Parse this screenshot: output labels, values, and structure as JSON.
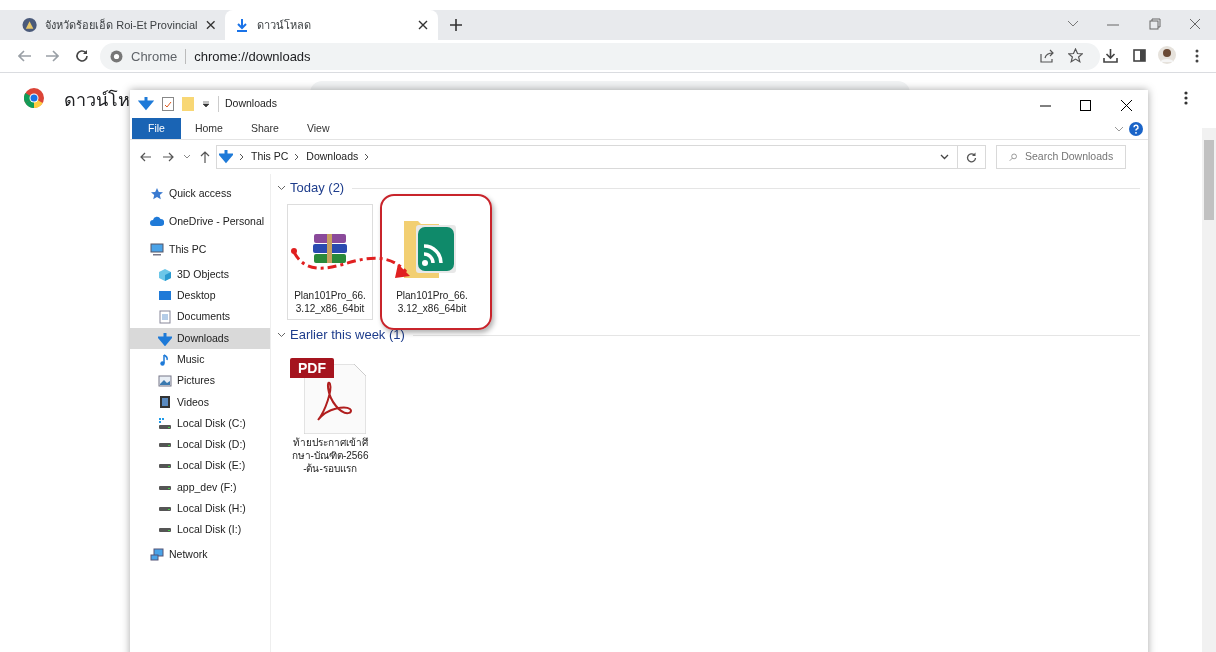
{
  "browser": {
    "tabs": [
      {
        "title": "จังหวัดร้อยเอ็ด Roi-Et Provincial",
        "kind": "seal",
        "selected": false
      },
      {
        "title": "ดาวน์โหลด",
        "kind": "download",
        "selected": true
      }
    ],
    "address": {
      "scheme_label": "Chrome",
      "url": "chrome://downloads"
    }
  },
  "page": {
    "heading": "ดาวน์โห"
  },
  "explorer": {
    "title": "Downloads",
    "ribbon_tabs": [
      {
        "label": "File",
        "selected": true
      },
      {
        "label": "Home",
        "selected": false
      },
      {
        "label": "Share",
        "selected": false
      },
      {
        "label": "View",
        "selected": false
      }
    ],
    "breadcrumb": [
      "This PC",
      "Downloads"
    ],
    "search": {
      "placeholder": "Search Downloads"
    },
    "nav": [
      {
        "label": "Quick access",
        "kind": "star",
        "selected": false
      },
      {
        "label": "OneDrive - Personal",
        "kind": "cloud",
        "selected": false
      },
      {
        "label": "This PC",
        "kind": "pc",
        "selected": false,
        "children": [
          {
            "label": "3D Objects",
            "kind": "cube",
            "selected": false
          },
          {
            "label": "Desktop",
            "kind": "desktop",
            "selected": false
          },
          {
            "label": "Documents",
            "kind": "documents",
            "selected": false
          },
          {
            "label": "Downloads",
            "kind": "download",
            "selected": true
          },
          {
            "label": "Music",
            "kind": "music",
            "selected": false
          },
          {
            "label": "Pictures",
            "kind": "pictures",
            "selected": false
          },
          {
            "label": "Videos",
            "kind": "videos",
            "selected": false
          },
          {
            "label": "Local Disk (C:)",
            "kind": "sysdisk",
            "selected": false
          },
          {
            "label": "Local Disk (D:)",
            "kind": "disk",
            "selected": false
          },
          {
            "label": "Local Disk (E:)",
            "kind": "disk",
            "selected": false
          },
          {
            "label": "app_dev (F:)",
            "kind": "disk",
            "selected": false
          },
          {
            "label": "Local Disk (H:)",
            "kind": "disk",
            "selected": false
          },
          {
            "label": "Local Disk (I:)",
            "kind": "disk",
            "selected": false
          }
        ]
      },
      {
        "label": "Network",
        "kind": "network",
        "selected": false
      }
    ],
    "groups": [
      {
        "title": "Today (2)",
        "items": [
          {
            "name": "Plan101Pro_66.3.12_x86_64bit",
            "kind": "archive",
            "selected": true,
            "highlighted": false
          },
          {
            "name": "Plan101Pro_66.3.12_x86_64bit",
            "kind": "app",
            "selected": false,
            "highlighted": true
          }
        ]
      },
      {
        "title": "Earlier this week (1)",
        "items": [
          {
            "name": "ท้ายประกาศเข้าศึกษา-บัณฑิต-2566-ต้น-รอบแรก",
            "kind": "pdf",
            "badge": "PDF",
            "selected": false,
            "highlighted": false
          }
        ]
      }
    ]
  }
}
